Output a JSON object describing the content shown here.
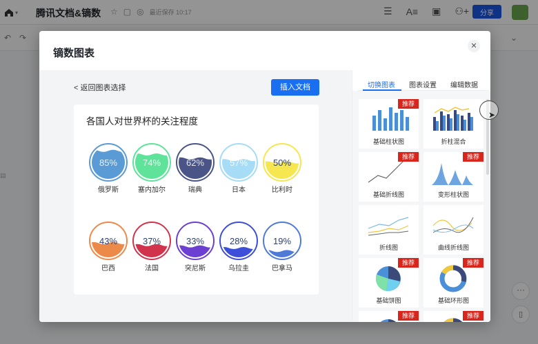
{
  "app": {
    "doc_title": "腾讯文档&镝数",
    "saved_status": "最近保存 10:17",
    "share_label": "分享"
  },
  "modal": {
    "title": "镝数图表",
    "close_icon": "close-icon",
    "back_label": "返回图表选择",
    "insert_label": "插入文档"
  },
  "tabs": [
    {
      "label": "切换图表",
      "active": true
    },
    {
      "label": "图表设置",
      "active": false
    },
    {
      "label": "编辑数据",
      "active": false
    }
  ],
  "chart_cards": [
    {
      "label": "基础柱状图",
      "badge": "推荐",
      "icon": "bar-chart-icon"
    },
    {
      "label": "折柱混合",
      "badge": "",
      "icon": "bar-line-mix-icon"
    },
    {
      "label": "基础折线图",
      "badge": "推荐",
      "icon": "line-chart-icon"
    },
    {
      "label": "变形柱状图",
      "badge": "推荐",
      "icon": "pictorial-bar-icon"
    },
    {
      "label": "折线图",
      "badge": "",
      "icon": "multi-line-icon"
    },
    {
      "label": "曲线折线图",
      "badge": "",
      "icon": "smooth-line-icon"
    },
    {
      "label": "基础饼图",
      "badge": "推荐",
      "icon": "pie-chart-icon"
    },
    {
      "label": "基础环形图",
      "badge": "推荐",
      "icon": "donut-chart-icon"
    },
    {
      "label": "",
      "badge": "推荐",
      "icon": "pie-chart-icon"
    },
    {
      "label": "",
      "badge": "推荐",
      "icon": "donut-chart-icon"
    }
  ],
  "chart_data": {
    "type": "liquid-fill",
    "title": "各国人对世界杯的关注程度",
    "categories": [
      "俄罗斯",
      "塞内加尔",
      "瑞典",
      "日本",
      "比利时",
      "巴西",
      "法国",
      "突尼斯",
      "乌拉圭",
      "巴拿马"
    ],
    "values": [
      85,
      74,
      62,
      57,
      50,
      43,
      37,
      33,
      28,
      19
    ],
    "value_labels": [
      "85%",
      "74%",
      "62%",
      "57%",
      "50%",
      "43%",
      "37%",
      "33%",
      "28%",
      "19%"
    ],
    "colors": [
      "#5b9bd5",
      "#5fe39a",
      "#4a5487",
      "#a6dcf5",
      "#f6e64f",
      "#ec8a4a",
      "#d0334b",
      "#6a3fd1",
      "#3d4fd8",
      "#4f7ad6"
    ]
  }
}
